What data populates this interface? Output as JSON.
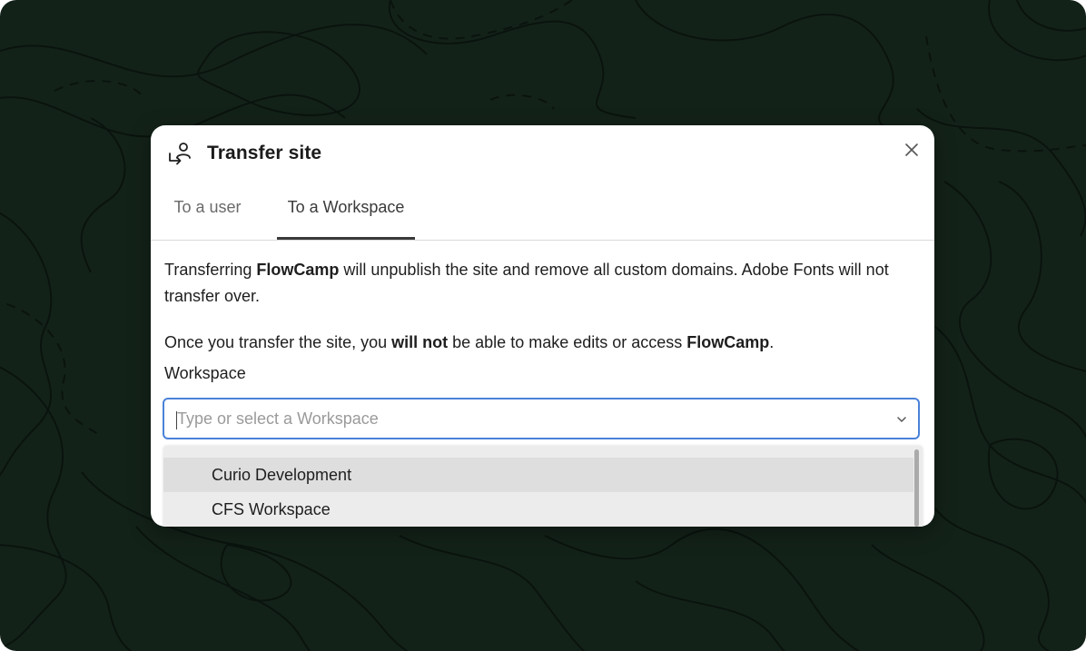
{
  "colors": {
    "background": "#132219",
    "contour_lines": "#0a130e",
    "focus_border": "#4a82d8",
    "dropdown_bg": "#ececec",
    "hover_bg": "#dedede"
  },
  "dialog": {
    "title": "Transfer site",
    "title_icon": "transfer-user-icon",
    "close_icon": "close-icon"
  },
  "tabs": [
    {
      "label": "To a user",
      "active": false
    },
    {
      "label": "To a Workspace",
      "active": true
    }
  ],
  "message": {
    "p1_before": "Transferring ",
    "site_name": "FlowCamp",
    "p1_after": " will unpublish the site and remove all custom domains. Adobe Fonts will not transfer over.",
    "p2_before": "Once you transfer the site, you ",
    "p2_emphasis": "will not",
    "p2_middle": " be able to make edits or access ",
    "p2_end": "."
  },
  "workspace_field": {
    "label": "Workspace",
    "value": "",
    "placeholder": "Type or select a Workspace",
    "chevron_icon": "chevron-down-icon"
  },
  "dropdown": {
    "options": [
      "Curio Development",
      "CFS Workspace"
    ],
    "highlighted_index": 0
  }
}
